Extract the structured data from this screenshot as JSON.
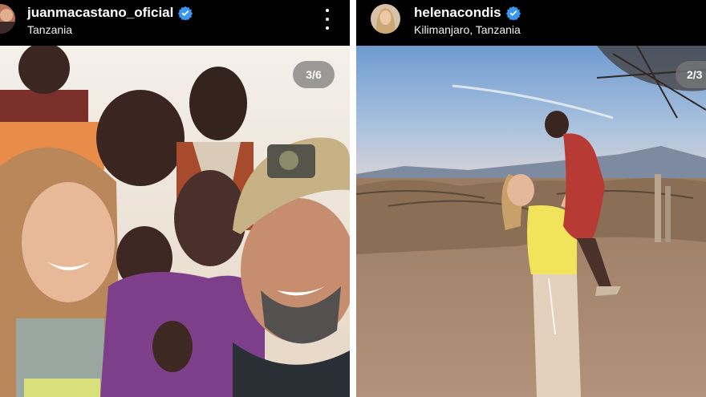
{
  "posts": [
    {
      "username": "juanmacastano_oficial",
      "location": "Tanzania",
      "verified": true,
      "counter": "3/6",
      "avatar_icon": "user-avatar-photo",
      "more_icon": "more-vertical-icon"
    },
    {
      "username": "helenacondis",
      "location": "Kilimanjaro, Tanzania",
      "verified": true,
      "counter": "2/3",
      "avatar_icon": "user-avatar-photo"
    }
  ],
  "colors": {
    "header_bg": "#000000",
    "verified_blue": "#3897f0",
    "counter_bg": "#787878"
  }
}
